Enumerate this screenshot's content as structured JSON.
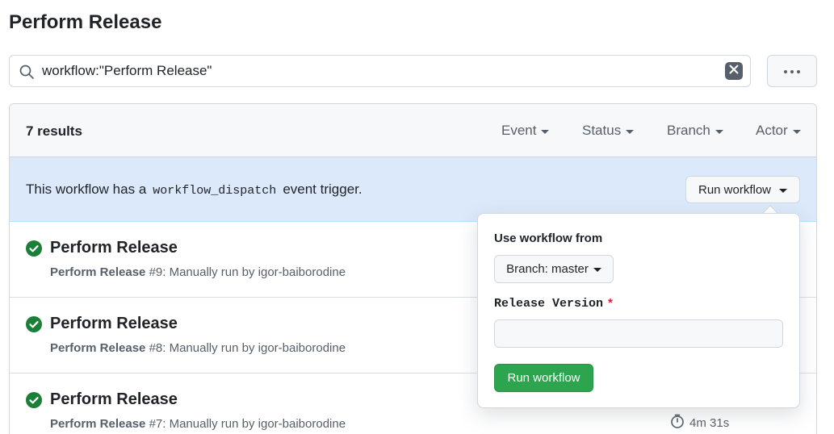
{
  "page": {
    "title": "Perform Release"
  },
  "search": {
    "value": "workflow:\"Perform Release\"",
    "clear_icon": "close-icon"
  },
  "more_button": {
    "icon": "kebab-horizontal-icon"
  },
  "runs": {
    "results_label": "7 results",
    "filters": [
      "Event",
      "Status",
      "Branch",
      "Actor"
    ],
    "banner": {
      "text_before": "This workflow has a",
      "code": "workflow_dispatch",
      "text_after": "event trigger.",
      "run_button_label": "Run workflow"
    },
    "items": [
      {
        "title": "Perform Release",
        "workflow": "Perform Release",
        "meta": " #9: Manually run by igor-baiborodine",
        "status": "success"
      },
      {
        "title": "Perform Release",
        "workflow": "Perform Release",
        "meta": " #8: Manually run by igor-baiborodine",
        "status": "success"
      },
      {
        "title": "Perform Release",
        "workflow": "Perform Release",
        "meta": " #7: Manually run by igor-baiborodine",
        "status": "success",
        "duration": "4m 31s"
      }
    ]
  },
  "run_popover": {
    "heading": "Use workflow from",
    "branch_button_label": "Branch: master",
    "input_label": "Release Version",
    "required_marker": "*",
    "input_value": "",
    "submit_label": "Run workflow"
  },
  "colors": {
    "success": "#1a7f37",
    "primary_button": "#2da44e",
    "banner_bg": "#dbe9fb",
    "required": "#cf222e"
  }
}
